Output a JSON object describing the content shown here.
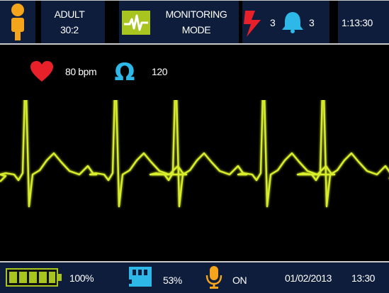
{
  "top": {
    "patient_line1": "ADULT",
    "patient_line2": "30:2",
    "mode_line1": "MONITORING",
    "mode_line2": "MODE",
    "shock_count": "3",
    "alarm_count": "3",
    "elapsed_time": "1:13:30"
  },
  "vitals": {
    "heart_rate": "80 bpm",
    "impedance": "120"
  },
  "bottom": {
    "battery": "100%",
    "memory": "53%",
    "voice": "ON",
    "date": "01/02/2013",
    "time": "13:30"
  },
  "icons": {
    "patient": "person-icon",
    "monitor": "ecg-monitor-icon",
    "shock": "lightning-icon",
    "alarm": "bell-icon",
    "heart": "heart-icon",
    "impedance": "omega-icon",
    "battery": "battery-icon",
    "memory": "sd-card-icon",
    "voice": "microphone-icon"
  },
  "colors": {
    "bar_bg": "#0f1d3d",
    "ecg_trace": "#d8ee2c",
    "accent_orange": "#f5a51c",
    "accent_red": "#e8202a",
    "accent_blue": "#2eb8e8",
    "accent_green": "#a8c51f"
  }
}
